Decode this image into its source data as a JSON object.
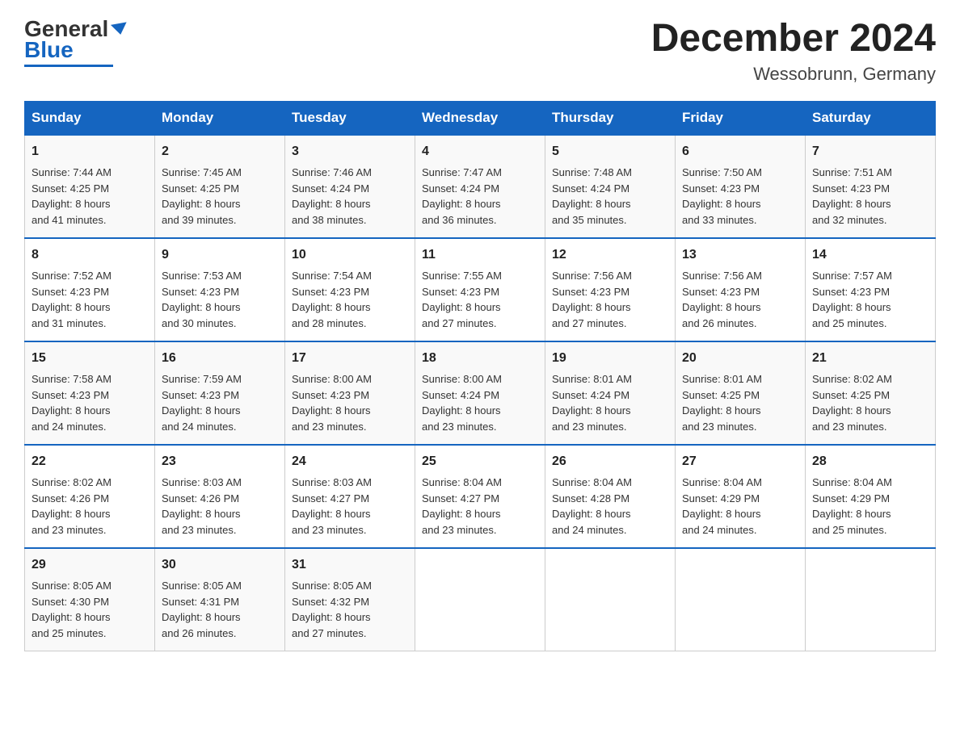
{
  "logo": {
    "general": "General",
    "blue": "Blue"
  },
  "title": "December 2024",
  "subtitle": "Wessobrunn, Germany",
  "days_of_week": [
    "Sunday",
    "Monday",
    "Tuesday",
    "Wednesday",
    "Thursday",
    "Friday",
    "Saturday"
  ],
  "weeks": [
    [
      {
        "day": "1",
        "sunrise": "7:44 AM",
        "sunset": "4:25 PM",
        "daylight": "8 hours and 41 minutes."
      },
      {
        "day": "2",
        "sunrise": "7:45 AM",
        "sunset": "4:25 PM",
        "daylight": "8 hours and 39 minutes."
      },
      {
        "day": "3",
        "sunrise": "7:46 AM",
        "sunset": "4:24 PM",
        "daylight": "8 hours and 38 minutes."
      },
      {
        "day": "4",
        "sunrise": "7:47 AM",
        "sunset": "4:24 PM",
        "daylight": "8 hours and 36 minutes."
      },
      {
        "day": "5",
        "sunrise": "7:48 AM",
        "sunset": "4:24 PM",
        "daylight": "8 hours and 35 minutes."
      },
      {
        "day": "6",
        "sunrise": "7:50 AM",
        "sunset": "4:23 PM",
        "daylight": "8 hours and 33 minutes."
      },
      {
        "day": "7",
        "sunrise": "7:51 AM",
        "sunset": "4:23 PM",
        "daylight": "8 hours and 32 minutes."
      }
    ],
    [
      {
        "day": "8",
        "sunrise": "7:52 AM",
        "sunset": "4:23 PM",
        "daylight": "8 hours and 31 minutes."
      },
      {
        "day": "9",
        "sunrise": "7:53 AM",
        "sunset": "4:23 PM",
        "daylight": "8 hours and 30 minutes."
      },
      {
        "day": "10",
        "sunrise": "7:54 AM",
        "sunset": "4:23 PM",
        "daylight": "8 hours and 28 minutes."
      },
      {
        "day": "11",
        "sunrise": "7:55 AM",
        "sunset": "4:23 PM",
        "daylight": "8 hours and 27 minutes."
      },
      {
        "day": "12",
        "sunrise": "7:56 AM",
        "sunset": "4:23 PM",
        "daylight": "8 hours and 27 minutes."
      },
      {
        "day": "13",
        "sunrise": "7:56 AM",
        "sunset": "4:23 PM",
        "daylight": "8 hours and 26 minutes."
      },
      {
        "day": "14",
        "sunrise": "7:57 AM",
        "sunset": "4:23 PM",
        "daylight": "8 hours and 25 minutes."
      }
    ],
    [
      {
        "day": "15",
        "sunrise": "7:58 AM",
        "sunset": "4:23 PM",
        "daylight": "8 hours and 24 minutes."
      },
      {
        "day": "16",
        "sunrise": "7:59 AM",
        "sunset": "4:23 PM",
        "daylight": "8 hours and 24 minutes."
      },
      {
        "day": "17",
        "sunrise": "8:00 AM",
        "sunset": "4:23 PM",
        "daylight": "8 hours and 23 minutes."
      },
      {
        "day": "18",
        "sunrise": "8:00 AM",
        "sunset": "4:24 PM",
        "daylight": "8 hours and 23 minutes."
      },
      {
        "day": "19",
        "sunrise": "8:01 AM",
        "sunset": "4:24 PM",
        "daylight": "8 hours and 23 minutes."
      },
      {
        "day": "20",
        "sunrise": "8:01 AM",
        "sunset": "4:25 PM",
        "daylight": "8 hours and 23 minutes."
      },
      {
        "day": "21",
        "sunrise": "8:02 AM",
        "sunset": "4:25 PM",
        "daylight": "8 hours and 23 minutes."
      }
    ],
    [
      {
        "day": "22",
        "sunrise": "8:02 AM",
        "sunset": "4:26 PM",
        "daylight": "8 hours and 23 minutes."
      },
      {
        "day": "23",
        "sunrise": "8:03 AM",
        "sunset": "4:26 PM",
        "daylight": "8 hours and 23 minutes."
      },
      {
        "day": "24",
        "sunrise": "8:03 AM",
        "sunset": "4:27 PM",
        "daylight": "8 hours and 23 minutes."
      },
      {
        "day": "25",
        "sunrise": "8:04 AM",
        "sunset": "4:27 PM",
        "daylight": "8 hours and 23 minutes."
      },
      {
        "day": "26",
        "sunrise": "8:04 AM",
        "sunset": "4:28 PM",
        "daylight": "8 hours and 24 minutes."
      },
      {
        "day": "27",
        "sunrise": "8:04 AM",
        "sunset": "4:29 PM",
        "daylight": "8 hours and 24 minutes."
      },
      {
        "day": "28",
        "sunrise": "8:04 AM",
        "sunset": "4:29 PM",
        "daylight": "8 hours and 25 minutes."
      }
    ],
    [
      {
        "day": "29",
        "sunrise": "8:05 AM",
        "sunset": "4:30 PM",
        "daylight": "8 hours and 25 minutes."
      },
      {
        "day": "30",
        "sunrise": "8:05 AM",
        "sunset": "4:31 PM",
        "daylight": "8 hours and 26 minutes."
      },
      {
        "day": "31",
        "sunrise": "8:05 AM",
        "sunset": "4:32 PM",
        "daylight": "8 hours and 27 minutes."
      },
      null,
      null,
      null,
      null
    ]
  ],
  "labels": {
    "sunrise": "Sunrise:",
    "sunset": "Sunset:",
    "daylight": "Daylight:"
  }
}
